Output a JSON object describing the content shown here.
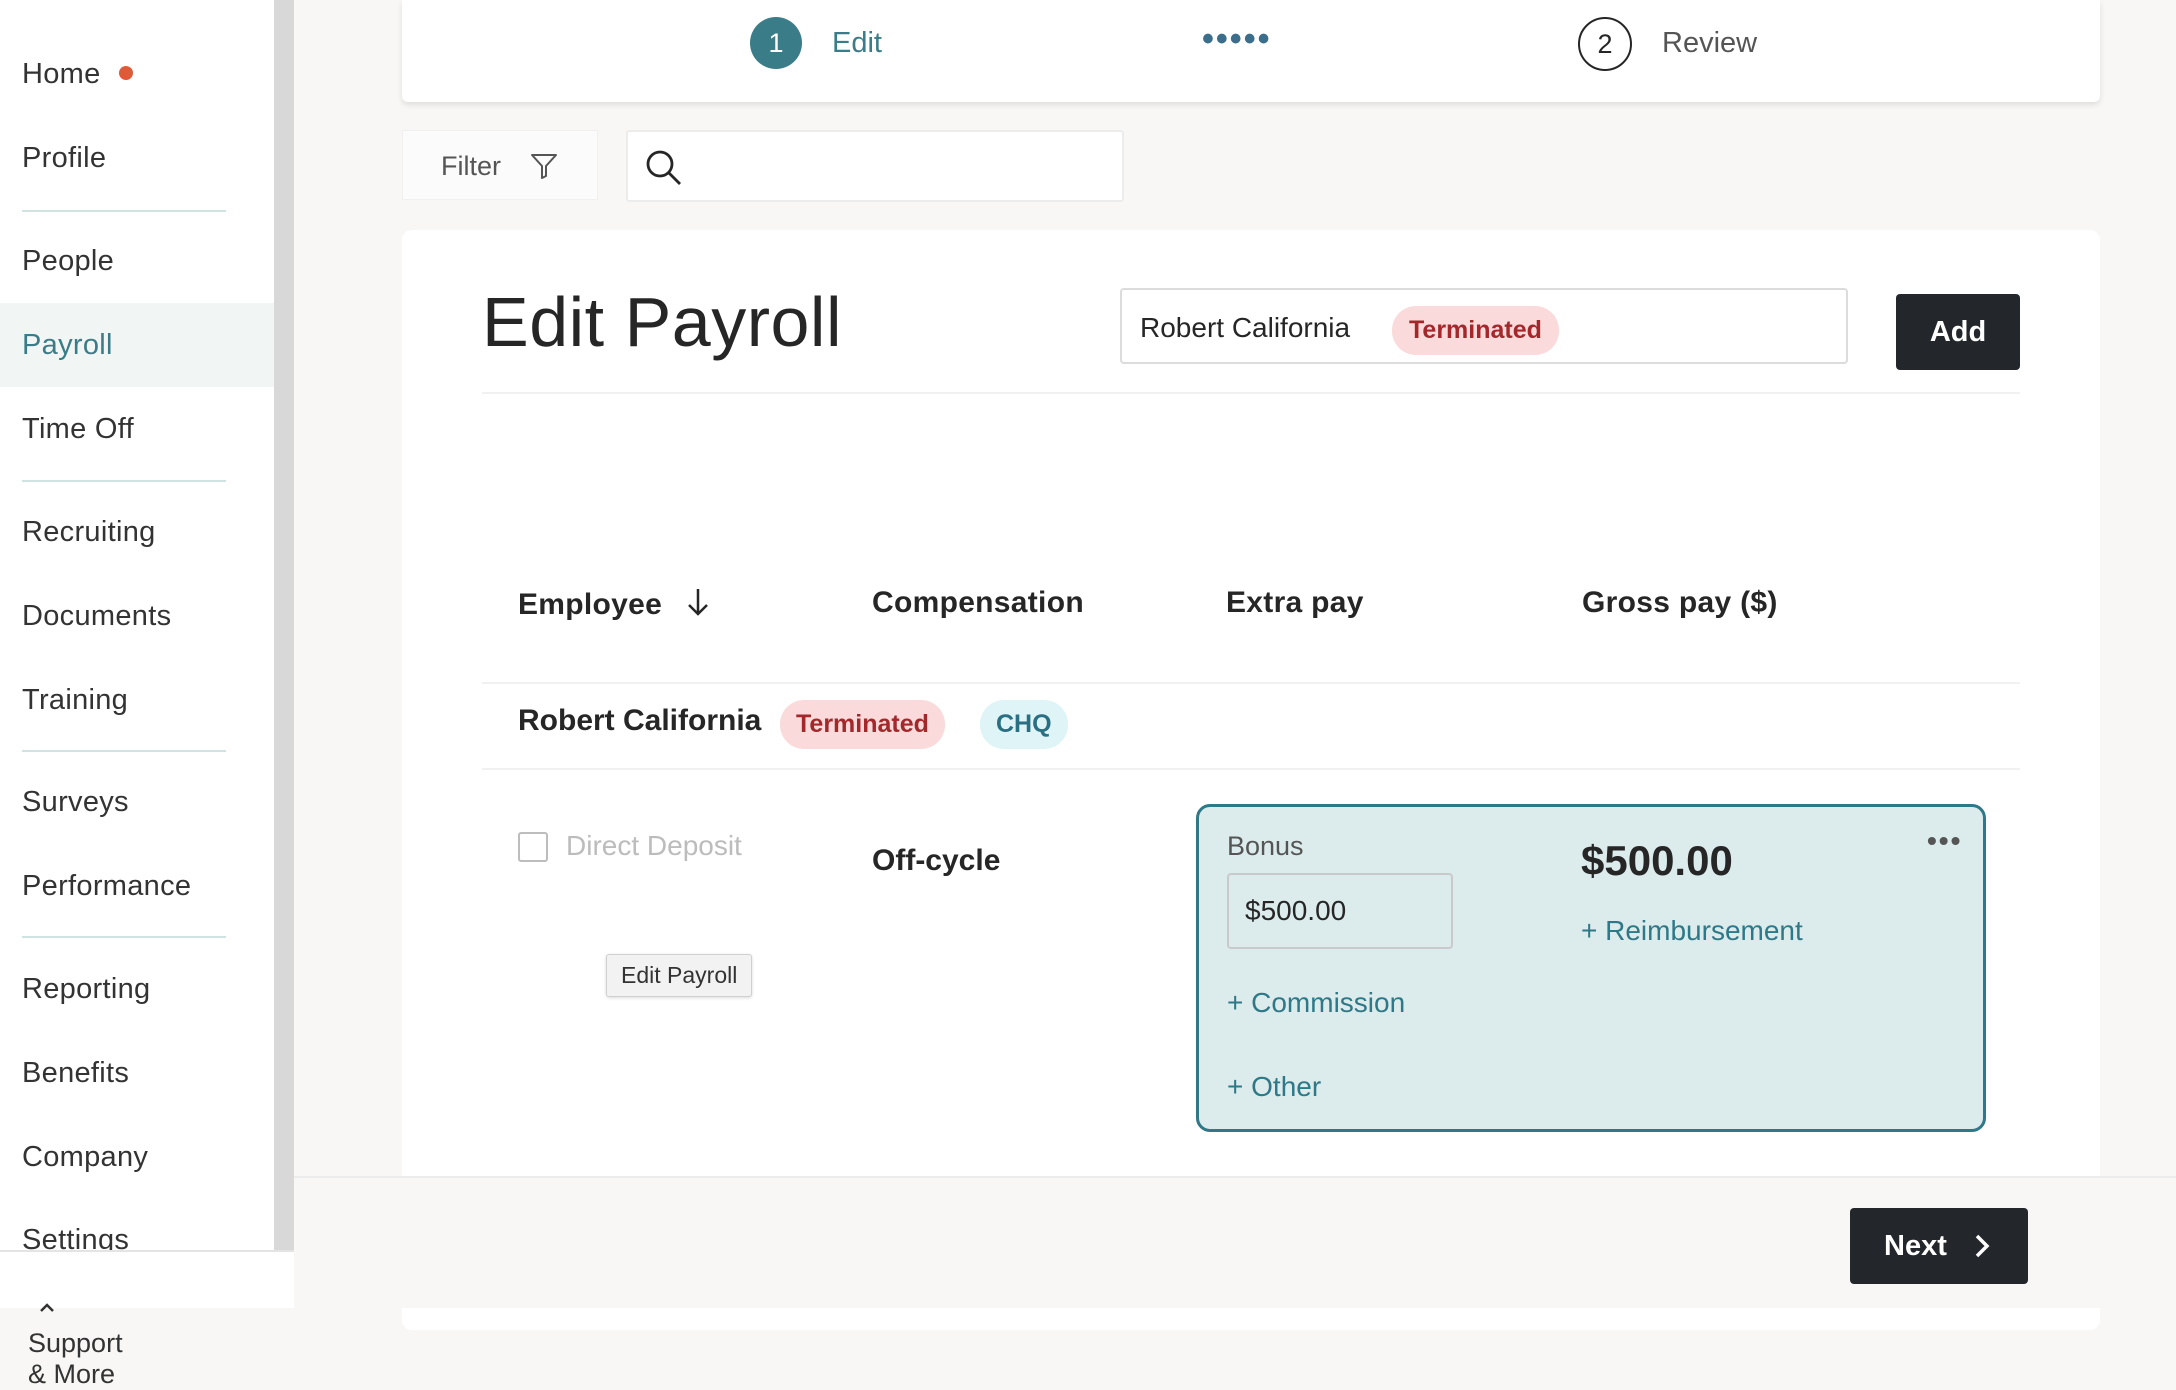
{
  "sidebar": {
    "items": [
      {
        "label": "Home"
      },
      {
        "label": "Profile"
      },
      {
        "label": "People"
      },
      {
        "label": "Payroll"
      },
      {
        "label": "Time Off"
      },
      {
        "label": "Recruiting"
      },
      {
        "label": "Documents"
      },
      {
        "label": "Training"
      },
      {
        "label": "Surveys"
      },
      {
        "label": "Performance"
      },
      {
        "label": "Reporting"
      },
      {
        "label": "Benefits"
      },
      {
        "label": "Company"
      },
      {
        "label": "Settings"
      }
    ],
    "active": "Payroll",
    "support_label": "Support & More"
  },
  "stepper": {
    "step1_num": "1",
    "step1_label": "Edit",
    "dots": "•••••",
    "step2_num": "2",
    "step2_label": "Review"
  },
  "toolbar": {
    "filter_label": "Filter",
    "search_value": ""
  },
  "page": {
    "title": "Edit Payroll",
    "employee_select": {
      "name": "Robert California",
      "status": "Terminated"
    },
    "add_label": "Add"
  },
  "table": {
    "headers": {
      "employee": "Employee",
      "compensation": "Compensation",
      "extra_pay": "Extra pay",
      "gross_pay": "Gross pay ($)"
    },
    "row": {
      "name": "Robert California",
      "status": "Terminated",
      "payment_method": "CHQ",
      "direct_deposit_label": "Direct Deposit",
      "direct_deposit_checked": false,
      "tooltip": "Edit Payroll",
      "compensation": "Off-cycle",
      "extra": {
        "bonus_label": "Bonus",
        "bonus_value": "$500.00",
        "commission_link": "+ Commission",
        "other_link": "+ Other",
        "reimbursement_link": "+ Reimbursement",
        "more": "•••"
      },
      "gross_pay": "$500.00"
    }
  },
  "footer": {
    "next_label": "Next"
  },
  "colors": {
    "accent": "#3a7c87",
    "dark_button": "#23262b",
    "terminated_bg": "#fadada",
    "terminated_text": "#a3282c",
    "home_dot": "#e05a38"
  }
}
